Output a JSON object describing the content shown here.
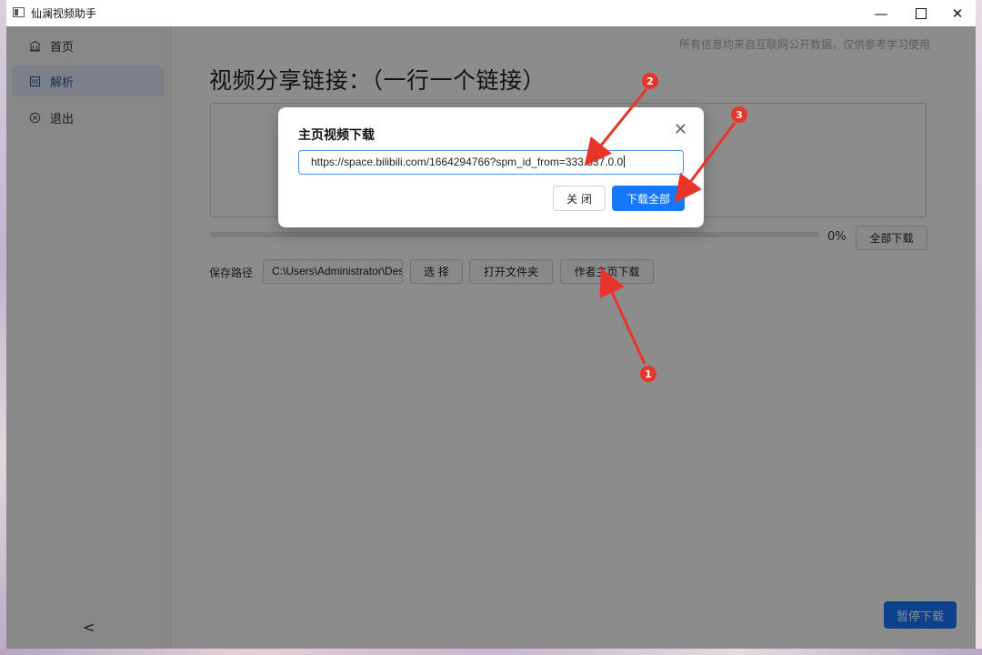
{
  "window": {
    "title": "仙澜视频助手",
    "controls": {
      "minimize": "—",
      "maximize": "",
      "close": "✕"
    }
  },
  "sidebar": {
    "items": [
      {
        "label": "首页",
        "icon": "home-icon"
      },
      {
        "label": "解析",
        "icon": "parse-icon"
      },
      {
        "label": "退出",
        "icon": "exit-icon"
      }
    ],
    "collapse": "<"
  },
  "main": {
    "disclaimer": "所有信息均来自互联网公开数据，仅供参考学习使用",
    "heading": "视频分享链接：（一行一个链接）",
    "links_text": "",
    "progress_percent": "0%",
    "progress_value": 0,
    "download_all_label": "全部下载",
    "save_path_label": "保存路径",
    "save_path_value": "C:\\Users\\Administrator\\Desktop",
    "choose_label": "选 择",
    "open_folder_label": "打开文件夹",
    "author_download_label": "作者主页下载",
    "pause_label": "暂停下载"
  },
  "modal": {
    "title": "主页视频下载",
    "close_icon": "✕",
    "url_value": "https://space.bilibili.com/1664294766?spm_id_from=333.337.0.0",
    "close_label": "关 闭",
    "download_all_label": "下载全部"
  },
  "annotations": [
    "1",
    "2",
    "3"
  ],
  "colors": {
    "accent": "#1677ff",
    "annotation": "#e8352c",
    "sidebar_active_bg": "#e4ecf6"
  }
}
